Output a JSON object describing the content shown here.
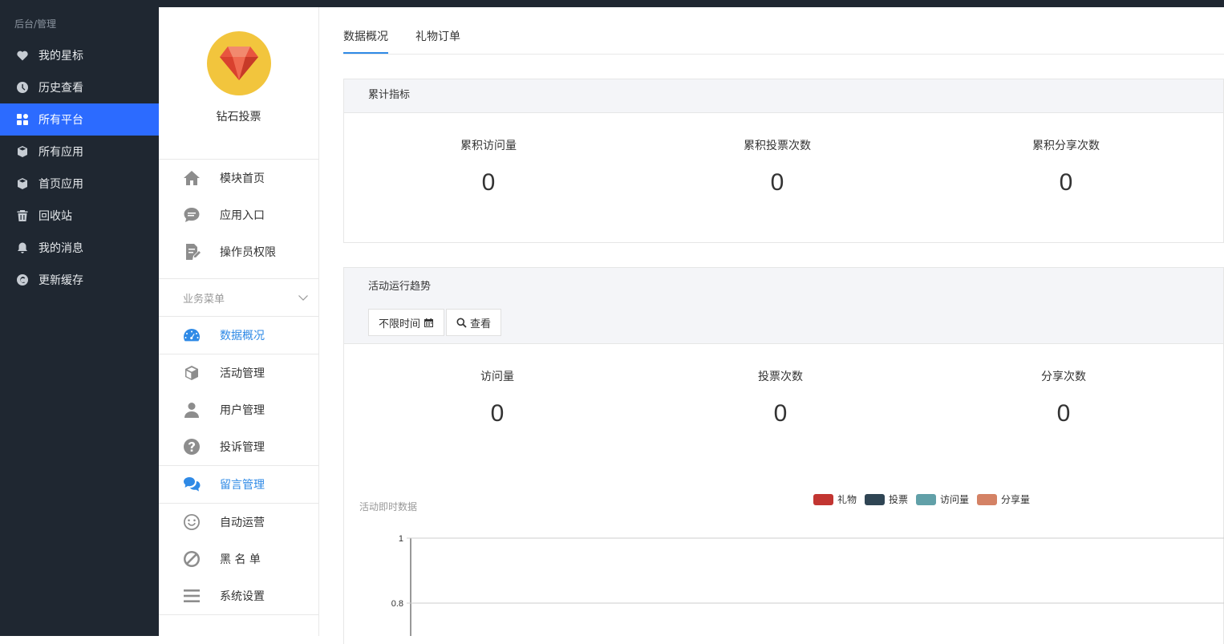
{
  "sidebar": {
    "crumb": "后台/管理",
    "items": [
      {
        "label": "我的星标",
        "icon": "heart-icon"
      },
      {
        "label": "历史查看",
        "icon": "clock-icon"
      },
      {
        "label": "所有平台",
        "icon": "grid-icon",
        "active": true
      },
      {
        "label": "所有应用",
        "icon": "cube-icon"
      },
      {
        "label": "首页应用",
        "icon": "cube-icon"
      },
      {
        "label": "回收站",
        "icon": "trash-icon"
      },
      {
        "label": "我的消息",
        "icon": "bell-icon"
      },
      {
        "label": "更新缓存",
        "icon": "copyright-icon"
      }
    ]
  },
  "module": {
    "name": "钻石投票",
    "logo_icon": "diamond-icon",
    "top_items": [
      {
        "label": "模块首页",
        "icon": "home-icon"
      },
      {
        "label": "应用入口",
        "icon": "chat-icon"
      },
      {
        "label": "操作员权限",
        "icon": "edit-doc-icon"
      }
    ],
    "group_title": "业务菜单",
    "group_items": [
      {
        "label": "数据概况",
        "icon": "dashboard-icon",
        "active": true
      },
      {
        "label": "活动管理",
        "icon": "cube-icon"
      },
      {
        "label": "用户管理",
        "icon": "user-icon"
      },
      {
        "label": "投诉管理",
        "icon": "question-icon"
      },
      {
        "label": "留言管理",
        "icon": "comments-icon",
        "active": true
      },
      {
        "label": "自动运营",
        "icon": "smile-icon"
      },
      {
        "label": "黑 名 单",
        "icon": "ban-icon"
      },
      {
        "label": "系统设置",
        "icon": "menu-icon"
      }
    ]
  },
  "tabs": [
    {
      "label": "数据概况",
      "active": true
    },
    {
      "label": "礼物订单"
    }
  ],
  "cumulative": {
    "title": "累计指标",
    "stats": [
      {
        "label": "累积访问量",
        "value": "0"
      },
      {
        "label": "累积投票次数",
        "value": "0"
      },
      {
        "label": "累积分享次数",
        "value": "0"
      }
    ]
  },
  "trend": {
    "title": "活动运行趋势",
    "time_button": "不限时间",
    "view_button": "查看",
    "stats": [
      {
        "label": "访问量",
        "value": "0"
      },
      {
        "label": "投票次数",
        "value": "0"
      },
      {
        "label": "分享次数",
        "value": "0"
      }
    ]
  },
  "chart_data": {
    "type": "line",
    "title": "活动即时数据",
    "series": [
      {
        "name": "礼物",
        "color": "#c23531",
        "values": []
      },
      {
        "name": "投票",
        "color": "#2f4554",
        "values": []
      },
      {
        "name": "访问量",
        "color": "#61a0a8",
        "values": []
      },
      {
        "name": "分享量",
        "color": "#d48265",
        "values": []
      }
    ],
    "ylim": [
      0,
      1
    ],
    "yticks": [
      "1",
      "0.8"
    ],
    "grid": true,
    "legend": "top-center"
  }
}
